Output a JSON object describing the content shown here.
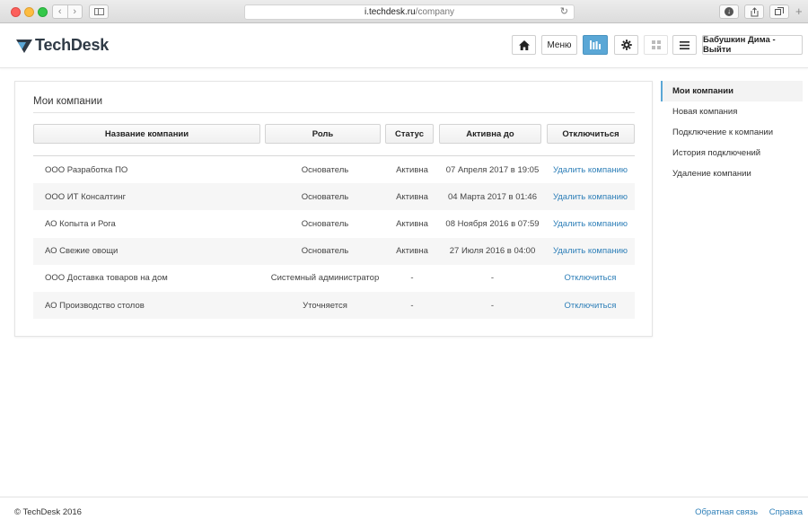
{
  "browser": {
    "url_host": "i.techdesk.ru",
    "url_path": "/company",
    "reload_icon": "reload-icon",
    "new_tab_glyph": "+"
  },
  "header": {
    "logo_text": "TechDesk",
    "menu_label": "Меню",
    "user_label": "Бабушкин Дима - Выйти",
    "active_color": "#5aa7d6"
  },
  "main": {
    "title": "Мои компании",
    "columns": {
      "name": "Название компании",
      "role": "Роль",
      "status": "Статус",
      "active_until": "Активна до",
      "disconnect": "Отключиться"
    },
    "rows": [
      {
        "name": "ООО Разработка ПО",
        "role": "Основатель",
        "status": "Активна",
        "active_until": "07 Апреля 2017 в 19:05",
        "action": "Удалить компанию"
      },
      {
        "name": "ООО ИТ Консалтинг",
        "role": "Основатель",
        "status": "Активна",
        "active_until": "04 Марта 2017 в 01:46",
        "action": "Удалить компанию"
      },
      {
        "name": "АО Копыта и Рога",
        "role": "Основатель",
        "status": "Активна",
        "active_until": "08 Ноября 2016 в 07:59",
        "action": "Удалить компанию"
      },
      {
        "name": "АО Свежие овощи",
        "role": "Основатель",
        "status": "Активна",
        "active_until": "27 Июля 2016 в 04:00",
        "action": "Удалить компанию"
      },
      {
        "name": "ООО Доставка товаров на дом",
        "role": "Системный администратор",
        "status": "-",
        "active_until": "-",
        "action": "Отключиться"
      },
      {
        "name": "АО Производство столов",
        "role": "Уточняется",
        "status": "-",
        "active_until": "-",
        "action": "Отключиться"
      }
    ]
  },
  "sidebar": {
    "items": [
      {
        "label": "Мои компании",
        "active": true
      },
      {
        "label": "Новая компания"
      },
      {
        "label": "Подключение к компании"
      },
      {
        "label": "История подключений"
      },
      {
        "label": "Удаление компании"
      }
    ]
  },
  "footer": {
    "copyright": "© TechDesk 2016",
    "feedback": "Обратная связь",
    "help": "Справка"
  },
  "colors": {
    "link": "#2e7fb8",
    "accent": "#5aa7d6"
  }
}
